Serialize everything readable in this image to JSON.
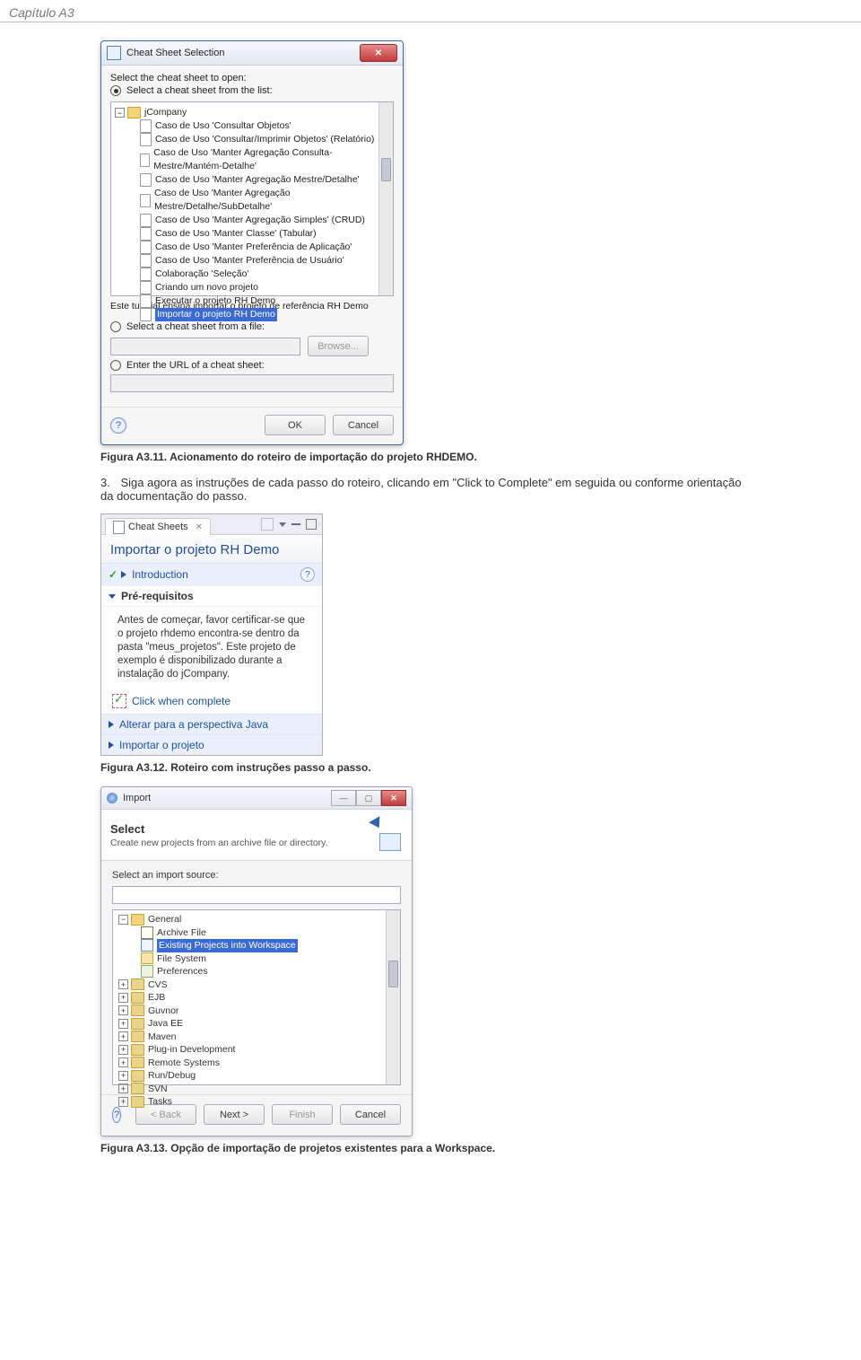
{
  "page_header": "Capítulo A3",
  "dialog1": {
    "title": "Cheat Sheet Selection",
    "select_prompt": "Select the cheat sheet to open:",
    "radio_list": "Select a cheat sheet from the list:",
    "root_folder": "jCompany",
    "items": [
      "Caso de Uso 'Consultar Objetos'",
      "Caso de Uso 'Consultar/Imprimir Objetos' (Relatório)",
      "Caso de Uso 'Manter Agregação Consulta-Mestre/Mantém-Detalhe'",
      "Caso de Uso 'Manter Agregação Mestre/Detalhe'",
      "Caso de Uso 'Manter Agregação Mestre/Detalhe/SubDetalhe'",
      "Caso de Uso 'Manter Agregação Simples' (CRUD)",
      "Caso de Uso 'Manter Classe' (Tabular)",
      "Caso de Uso 'Manter Preferência de Aplicação'",
      "Caso de Uso 'Manter Preferência de Usuário'",
      "Colaboração 'Seleção'",
      "Criando um novo projeto",
      "Executar o projeto RH Demo",
      "Importar o projeto RH Demo"
    ],
    "desc": "Este tutorial ensina importar o projeto de referência RH Demo",
    "radio_file": "Select a cheat sheet from a file:",
    "browse": "Browse...",
    "radio_url": "Enter the URL of a cheat sheet:",
    "ok": "OK",
    "cancel": "Cancel"
  },
  "caption1": "Figura A3.11. Acionamento do roteiro de importação do projeto RHDEMO.",
  "step3_num": "3.",
  "step3_text": "Siga agora as instruções de cada passo do roteiro, clicando em \"Click to Complete\" em seguida ou conforme orientação da documentação do passo.",
  "panel": {
    "tab_title": "Cheat Sheets",
    "big_title": "Importar o projeto RH Demo",
    "intro": "Introduction",
    "prereq": "Pré-requisitos",
    "body": "Antes de começar, favor certificar-se que o projeto rhdemo encontra-se dentro da pasta \"meus_projetos\". Este projeto de exemplo é disponibilizado durante a instalação do jCompany.",
    "click_complete": "Click when complete",
    "item_a": "Alterar para a perspectiva Java",
    "item_b": "Importar o projeto"
  },
  "caption2": "Figura A3.12. Roteiro com instruções passo a passo.",
  "import_dlg": {
    "title": "Import",
    "header_big": "Select",
    "header_sub": "Create new projects from an archive file or directory.",
    "source_label": "Select an import source:",
    "general": "General",
    "leaf_archive": "Archive File",
    "leaf_existing": "Existing Projects into Workspace",
    "leaf_fs": "File System",
    "leaf_prefs": "Preferences",
    "cats": [
      "CVS",
      "EJB",
      "Guvnor",
      "Java EE",
      "Maven",
      "Plug-in Development",
      "Remote Systems",
      "Run/Debug",
      "SVN",
      "Tasks"
    ],
    "back": "< Back",
    "next": "Next >",
    "finish": "Finish",
    "cancel": "Cancel"
  },
  "caption3": "Figura A3.13. Opção de importação de projetos existentes para a Workspace."
}
